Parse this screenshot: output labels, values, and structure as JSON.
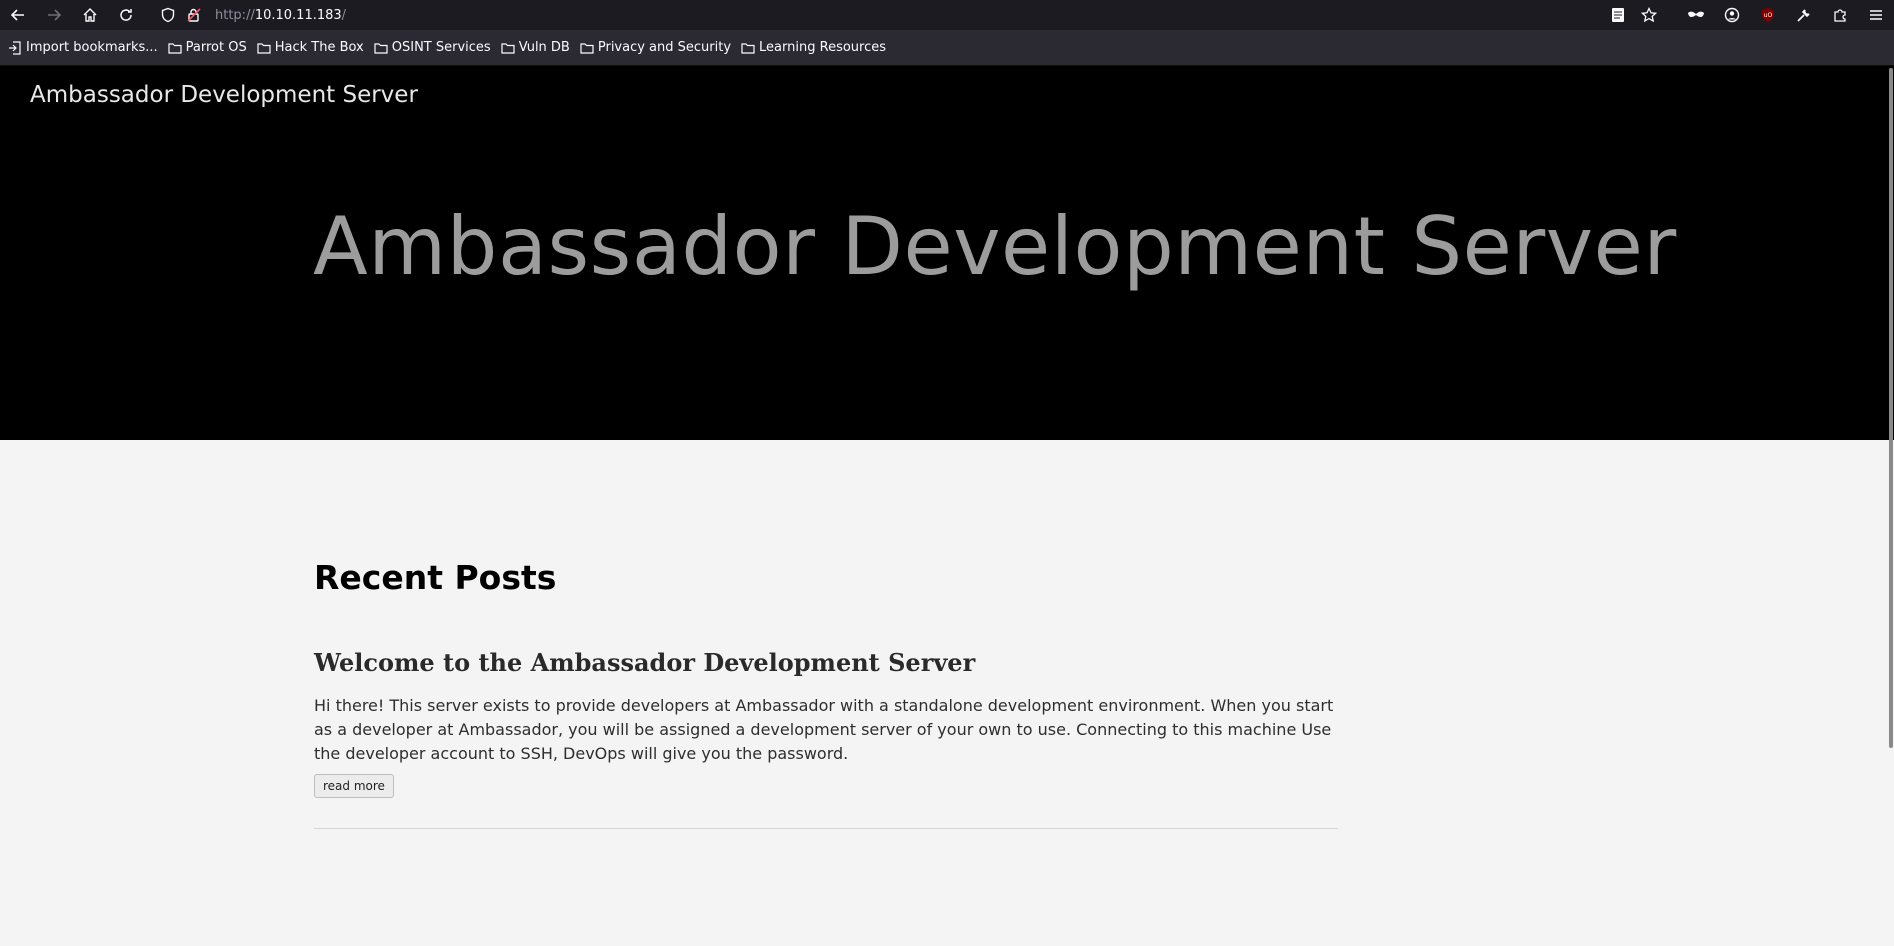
{
  "browser": {
    "url_scheme": "http://",
    "url_host": "10.10.11.183",
    "url_path": "/",
    "icons": {
      "back": "back-arrow-icon",
      "forward": "forward-arrow-icon",
      "home": "home-icon",
      "reload": "reload-icon",
      "tracking_protection": "shield-icon",
      "insecure": "insecure-lock-icon",
      "reader": "reader-view-icon",
      "bookmark": "star-icon",
      "private": "mask-icon",
      "account": "account-icon",
      "ublock": "ublock-icon",
      "tools": "wrench-icon",
      "extensions": "puzzle-icon",
      "menu": "hamburger-menu-icon"
    },
    "bookmarks": [
      {
        "label": "Import bookmarks...",
        "icon": "import-icon"
      },
      {
        "label": "Parrot OS",
        "icon": "folder-icon"
      },
      {
        "label": "Hack The Box",
        "icon": "folder-icon"
      },
      {
        "label": "OSINT Services",
        "icon": "folder-icon"
      },
      {
        "label": "Vuln DB",
        "icon": "folder-icon"
      },
      {
        "label": "Privacy and Security",
        "icon": "folder-icon"
      },
      {
        "label": "Learning Resources",
        "icon": "folder-icon"
      }
    ]
  },
  "site": {
    "title": "Ambassador Development Server",
    "hero_title": "Ambassador Development Server"
  },
  "posts_section": {
    "heading": "Recent Posts",
    "posts": [
      {
        "title": "Welcome to the Ambassador Development Server",
        "excerpt": "Hi there! This server exists to provide developers at Ambassador with a standalone development environment. When you start as a developer at Ambassador, you will be assigned a development server of your own to use. Connecting to this machine Use the developer account to SSH, DevOps will give you the password.",
        "read_more_label": "read more"
      }
    ]
  },
  "colors": {
    "chrome_bg": "#1c1b22",
    "bookmarks_bg": "#2b2a33",
    "hero_bg": "#000000",
    "hero_text": "#9c9c9c",
    "page_bg": "#f4f4f4"
  }
}
